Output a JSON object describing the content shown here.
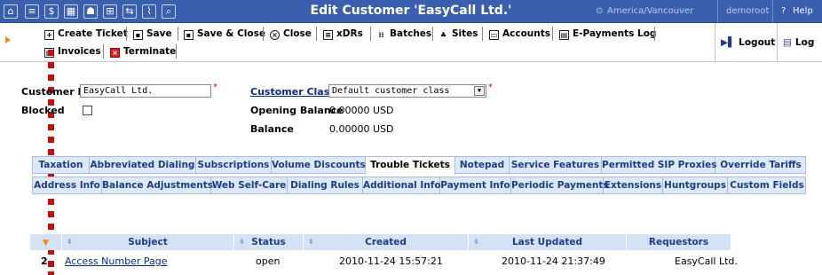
{
  "window": {
    "title": "Edit Customer 'EasyCall Ltd.'",
    "timezone": "America/Vancouver",
    "user": "demoroot",
    "help_label": "Help"
  },
  "toolbar": {
    "row1": [
      {
        "label": "Create Ticket",
        "icon": "plus-box-icon"
      },
      {
        "label": "Save",
        "icon": "floppy-icon"
      },
      {
        "label": "Save & Close",
        "icon": "floppy-close-icon"
      },
      {
        "label": "Close",
        "icon": "close-circle-icon"
      },
      {
        "label": "xDRs",
        "icon": "list-icon"
      },
      {
        "label": "Batches",
        "icon": "batches-icon"
      },
      {
        "label": "Sites",
        "icon": "sites-icon"
      },
      {
        "label": "Accounts",
        "icon": "accounts-icon"
      },
      {
        "label": "E-Payments Log",
        "icon": "epayments-icon"
      }
    ],
    "row2": [
      {
        "label": "Invoices",
        "icon": "invoice-icon"
      },
      {
        "label": "Terminate",
        "icon": "terminate-icon"
      }
    ],
    "logout_label": "Logout",
    "log_label": "Log"
  },
  "form": {
    "customer_id_label": "Customer ID",
    "customer_id_value": "EasyCall Ltd.",
    "blocked_label": "Blocked",
    "customer_class_label": "Customer Class",
    "customer_class_value": "Default customer class",
    "opening_balance_label": "Opening Balance",
    "opening_balance_value": "0.00000 USD",
    "balance_label": "Balance",
    "balance_value": "0.00000 USD",
    "required_mark": "*"
  },
  "tabs": {
    "row1": [
      "Taxation",
      "Abbreviated Dialing",
      "Subscriptions",
      "Volume Discounts",
      "Trouble Tickets",
      "Notepad",
      "Service Features",
      "Permitted SIP Proxies",
      "Override Tariffs"
    ],
    "row2": [
      "Address Info",
      "Balance Adjustments",
      "Web Self-Care",
      "Dialing Rules",
      "Additional Info",
      "Payment Info",
      "Periodic Payments",
      "Extensions",
      "Huntgroups",
      "Custom Fields"
    ],
    "active": "Trouble Tickets"
  },
  "tickets": {
    "columns": [
      "Subject",
      "Status",
      "Created",
      "Last Updated",
      "Requestors"
    ],
    "rows": [
      {
        "id": "2",
        "subject": "Access Number Page",
        "status": "open",
        "created": "2010-11-24 15:57:21",
        "updated": "2010-11-24 21:37:49",
        "requestors": "EasyCall Ltd."
      }
    ]
  }
}
